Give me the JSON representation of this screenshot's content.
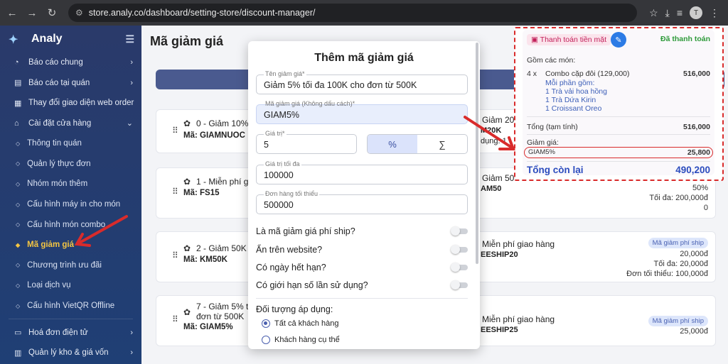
{
  "browser": {
    "url": "store.analy.co/dashboard/setting-store/discount-manager/",
    "avatar": "T"
  },
  "sidebar": {
    "brand": "Analy",
    "items": [
      {
        "label": "Báo cáo chung",
        "icon": "chart-icon",
        "chev": "›"
      },
      {
        "label": "Báo cáo tại quán",
        "icon": "report-icon",
        "chev": "›"
      },
      {
        "label": "Thay đổi giao diện web order",
        "icon": "layout-icon",
        "chev": ""
      },
      {
        "label": "Cài đặt cửa hàng",
        "icon": "store-icon",
        "chev": "⌄"
      }
    ],
    "subs": [
      "Thông tin quán",
      "Quản lý thực đơn",
      "Nhóm món thêm",
      "Cấu hình máy in cho món",
      "Cấu hình món combo",
      "Mã giảm giá",
      "Chương trình ưu đãi",
      "Loại dịch vụ",
      "Cấu hình VietQR Offline"
    ],
    "bottom": [
      {
        "label": "Hoá đơn điện tử",
        "icon": "invoice-icon"
      },
      {
        "label": "Quản lý kho & giá vốn",
        "icon": "warehouse-icon"
      }
    ]
  },
  "main": {
    "title": "Mã giảm giá",
    "left_cards": [
      {
        "name": "0 - Giảm 10% mo",
        "code": "Mã: GIAMNUOC"
      },
      {
        "name": "1 - Miễn phí giao",
        "code": "Mã: FS15"
      },
      {
        "name": "2 - Giảm 50K đơn",
        "code": "Mã: KM50K"
      },
      {
        "name": "7 - Giảm 5% tối đ",
        "name2": "đơn từ 500K",
        "code": "Mã: GIAM5%"
      }
    ],
    "right_cards": [
      {
        "name": "Giảm 20",
        "code": "M20K",
        "extra": "dụng: 1",
        "badge": "",
        "vals": []
      },
      {
        "name": "Giảm 50",
        "code": "AM50",
        "badge": "",
        "vals": [
          "50%",
          "Tối đa: 200,000đ",
          "0"
        ]
      },
      {
        "name": "Miễn phí giao hàng",
        "code": "EESHIP20",
        "badge": "Mã giảm phí ship",
        "vals": [
          "20,000đ",
          "Tối đa: 20,000đ",
          "Đơn tối thiểu: 100,000đ"
        ]
      },
      {
        "name": "Miễn phí giao hàng",
        "code": "EESHIP25",
        "badge": "Mã giảm phí ship",
        "vals": [
          "25,000đ"
        ]
      }
    ]
  },
  "modal": {
    "title": "Thêm mã giảm giá",
    "name_label": "Tên giảm giá*",
    "name_value": "Giảm 5% tối đa 100K cho đơn từ 500K",
    "code_label": "Mã giảm giá (Không dấu cách)*",
    "code_value": "GIAM5%",
    "value_label": "Giá trị*",
    "value_value": "5",
    "seg_percent": "%",
    "seg_sum": "∑",
    "max_label": "Giá trị tối đa",
    "max_value": "100000",
    "min_label": "Đơn hàng tối thiểu",
    "min_value": "500000",
    "toggles": [
      "Là mã giảm giá phí ship?",
      "Ẩn trên website?",
      "Có ngày hết hạn?",
      "Có giới hạn số lần sử dụng?"
    ],
    "apply_label": "Đối tượng áp dụng:",
    "radio_all": "Tất cả khách hàng",
    "radio_specific": "Khách hàng cụ thể"
  },
  "receipt": {
    "pay_method": "Thanh toán tiền mặt",
    "status": "Đã thanh toán",
    "includes": "Gồm các món:",
    "qty": "4 x",
    "item_name": "Combo cặp đôi (129,000)",
    "item_price": "516,000",
    "each_includes": "Mỗi phần gồm:",
    "subitems": [
      "1 Trà vải hoa hồng",
      "1 Trà Dứa Kirin",
      "1 Croissant Oreo"
    ],
    "subtotal_label": "Tổng (tạm tính)",
    "subtotal_value": "516,000",
    "discount_label": "Giảm giá:",
    "discount_code": "GIAM5%",
    "discount_value": "25,800",
    "remaining_label": "Tổng còn lại",
    "remaining_value": "490,200"
  },
  "colors": {
    "sidebar": "#2a3a6a",
    "accent": "#f4c542",
    "annotation": "#d92b2b",
    "total": "#2c4cbe"
  }
}
